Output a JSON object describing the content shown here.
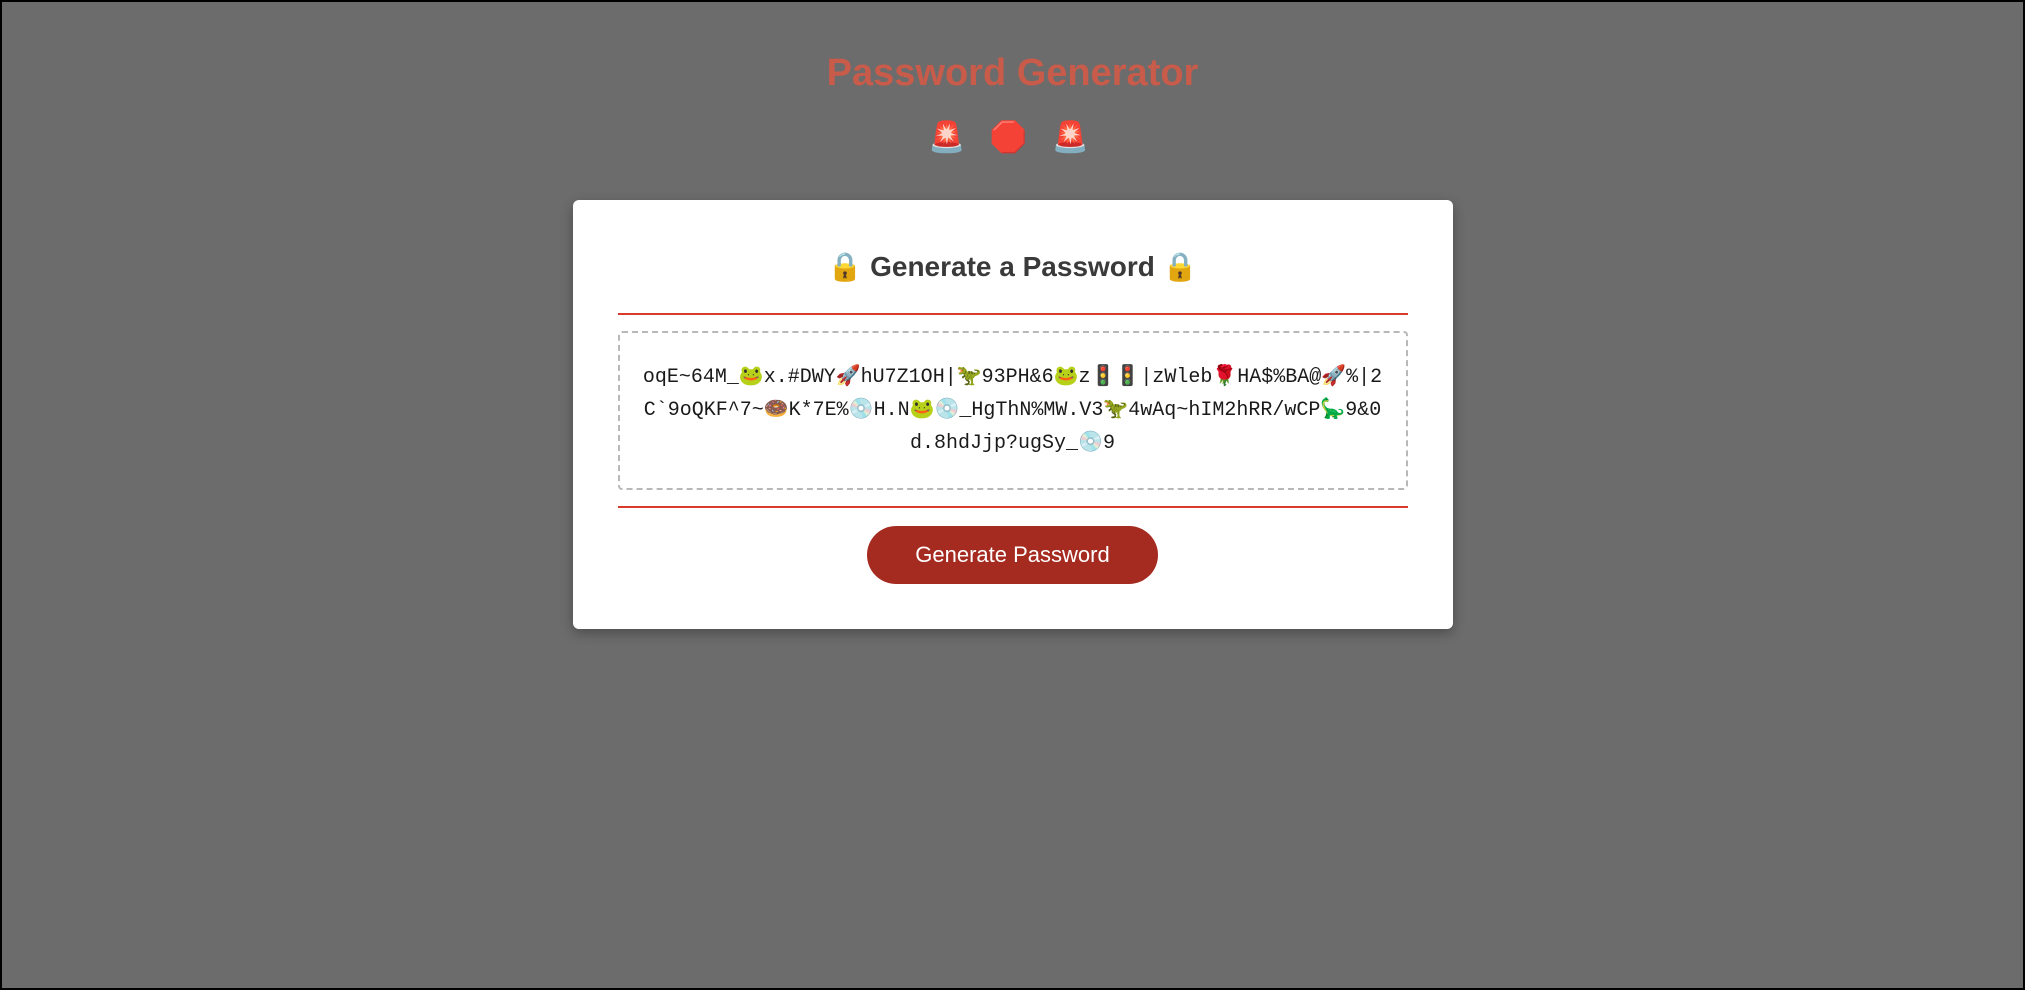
{
  "header": {
    "title": "Password Generator",
    "icons": "🚨 🛑 🚨"
  },
  "card": {
    "heading": "🔒 Generate a Password 🔒",
    "password_value": "oqE~64M_🐸x.#DWY🚀hU7Z1OH|🦖93PH&6🐸z🚦🚦|zWleb🌹HA$%BA@🚀%|2C`9oQKF^7~🍩K*7E%💿H.N🐸💿_HgThN%MW.V3🦖4wAq~hIM2hRR/wCP🦕9&0d.8hdJjp?ugSy_💿9",
    "button_label": "Generate Password"
  }
}
